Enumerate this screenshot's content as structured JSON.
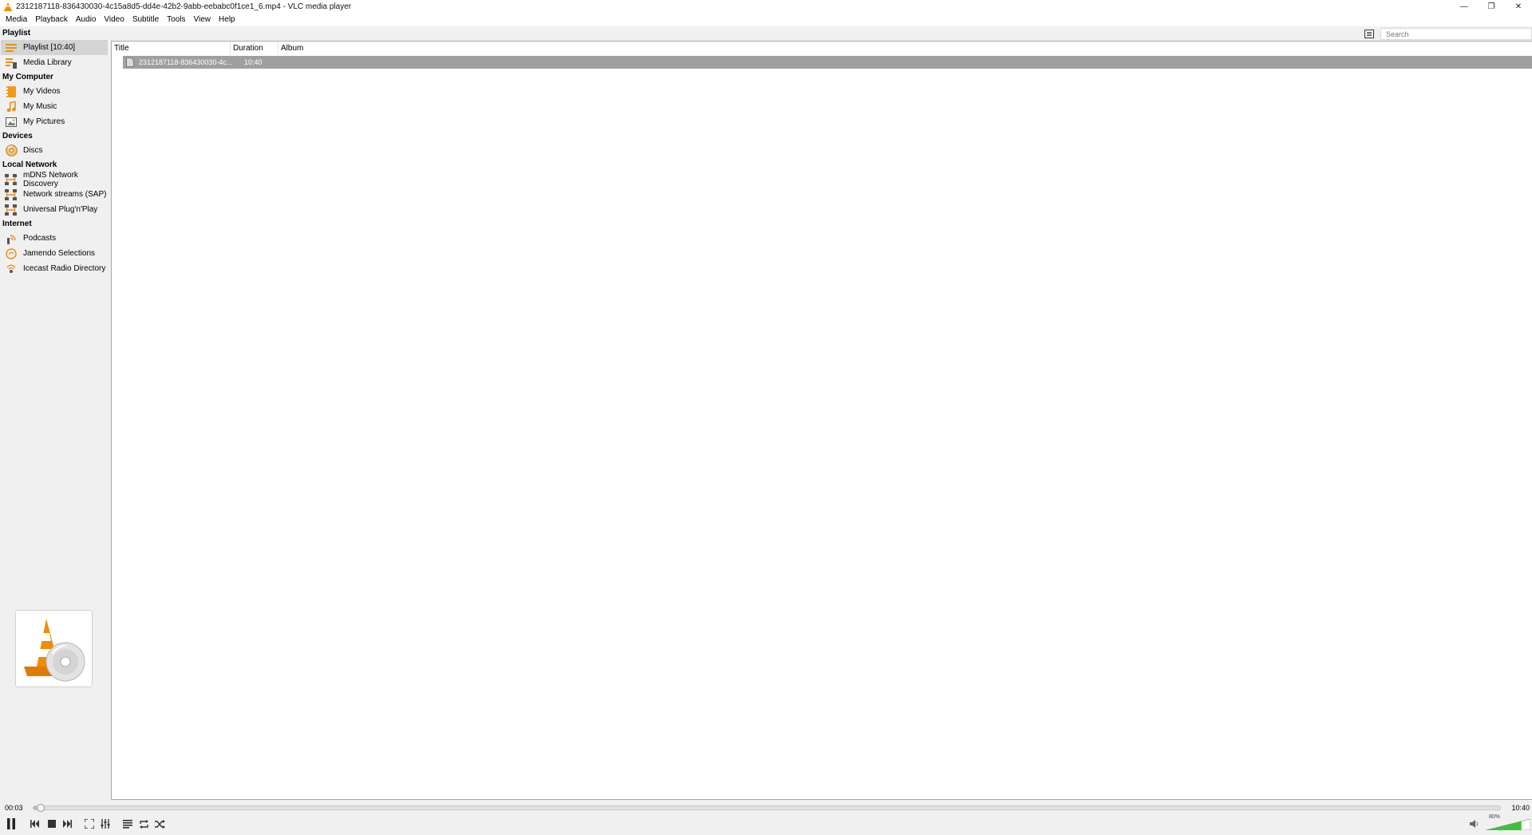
{
  "window": {
    "title": "2312187118-836430030-4c15a8d5-dd4e-42b2-9abb-eebabc0f1ce1_6.mp4 - VLC media player",
    "minimize": "—",
    "restore": "❐",
    "close": "✕"
  },
  "menu": [
    "Media",
    "Playback",
    "Audio",
    "Video",
    "Subtitle",
    "Tools",
    "View",
    "Help"
  ],
  "sidebar": {
    "sections": [
      {
        "header": "Playlist",
        "items": [
          {
            "label": "Playlist [10:40]",
            "icon": "playlist-icon",
            "selected": true
          },
          {
            "label": "Media Library",
            "icon": "media-library-icon"
          }
        ]
      },
      {
        "header": "My Computer",
        "items": [
          {
            "label": "My Videos",
            "icon": "videos-icon"
          },
          {
            "label": "My Music",
            "icon": "music-icon"
          },
          {
            "label": "My Pictures",
            "icon": "pictures-icon"
          }
        ]
      },
      {
        "header": "Devices",
        "items": [
          {
            "label": "Discs",
            "icon": "disc-icon"
          }
        ]
      },
      {
        "header": "Local Network",
        "items": [
          {
            "label": "mDNS Network Discovery",
            "icon": "network-icon"
          },
          {
            "label": "Network streams (SAP)",
            "icon": "network-icon"
          },
          {
            "label": "Universal Plug'n'Play",
            "icon": "network-icon"
          }
        ]
      },
      {
        "header": "Internet",
        "items": [
          {
            "label": "Podcasts",
            "icon": "podcast-icon"
          },
          {
            "label": "Jamendo Selections",
            "icon": "jamendo-icon"
          },
          {
            "label": "Icecast Radio Directory",
            "icon": "icecast-icon"
          }
        ]
      }
    ]
  },
  "search": {
    "placeholder": "Search"
  },
  "playlist": {
    "columns": {
      "title": "Title",
      "duration": "Duration",
      "album": "Album"
    },
    "rows": [
      {
        "title": "2312187118-836430030-4c...",
        "duration": "10:40",
        "album": ""
      }
    ]
  },
  "player": {
    "current_time": "00:03",
    "total_time": "10:40",
    "progress_fraction": 0.005,
    "volume_label": "80%",
    "volume_fraction": 0.8
  },
  "colors": {
    "accent_orange": "#f28c00",
    "volume_green": "#3cc13c",
    "selection_gray": "#9f9f9f"
  }
}
